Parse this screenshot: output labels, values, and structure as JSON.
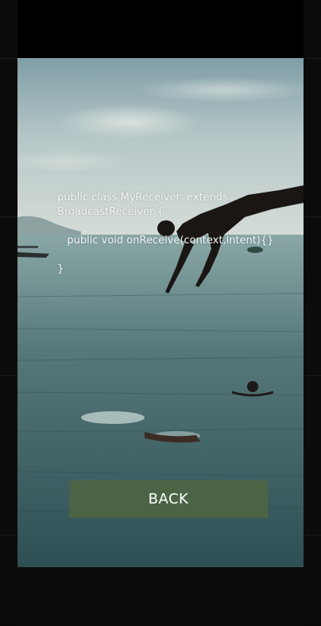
{
  "screen": {
    "code_text": "public class MyReceiver  extends BroadcastReceiver {\n\n   public void onReceive(context,intent){}\n\n}",
    "back_label": "BACK"
  },
  "colors": {
    "button_bg": "#4c6445",
    "button_text": "#ffffff",
    "frame": "#0b0b0b"
  },
  "background_image": "ocean-swimmers-diver-photo"
}
